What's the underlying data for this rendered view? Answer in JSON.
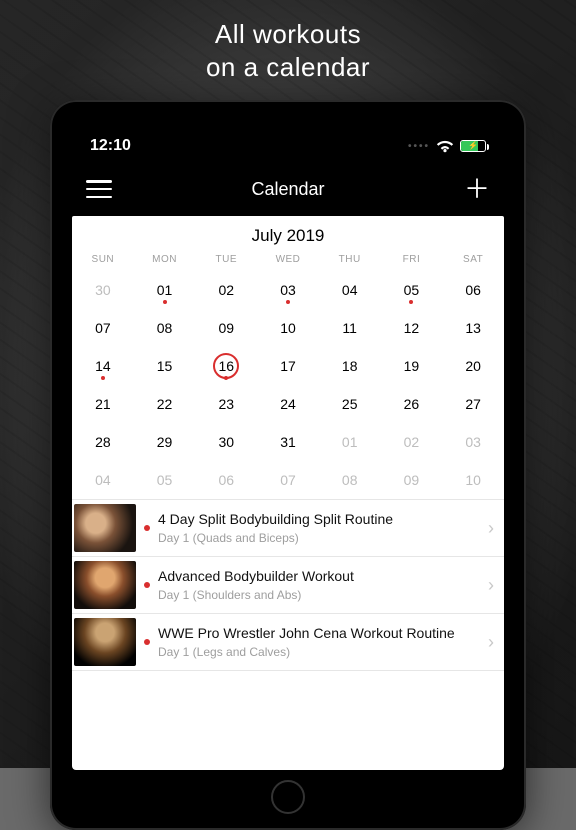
{
  "promo": {
    "line1": "All workouts",
    "line2": "on a calendar"
  },
  "status": {
    "time": "12:10"
  },
  "nav": {
    "title": "Calendar"
  },
  "calendar": {
    "month_label": "July 2019",
    "weekdays": [
      "SUN",
      "MON",
      "TUE",
      "WED",
      "THU",
      "FRI",
      "SAT"
    ],
    "weeks": [
      [
        {
          "d": "30",
          "o": true
        },
        {
          "d": "01",
          "dot": true
        },
        {
          "d": "02"
        },
        {
          "d": "03",
          "dot": true
        },
        {
          "d": "04"
        },
        {
          "d": "05",
          "dot": true
        },
        {
          "d": "06"
        }
      ],
      [
        {
          "d": "07"
        },
        {
          "d": "08"
        },
        {
          "d": "09"
        },
        {
          "d": "10"
        },
        {
          "d": "11"
        },
        {
          "d": "12"
        },
        {
          "d": "13"
        }
      ],
      [
        {
          "d": "14",
          "dot": true
        },
        {
          "d": "15"
        },
        {
          "d": "16",
          "today": true,
          "dot": true
        },
        {
          "d": "17"
        },
        {
          "d": "18"
        },
        {
          "d": "19"
        },
        {
          "d": "20"
        }
      ],
      [
        {
          "d": "21"
        },
        {
          "d": "22"
        },
        {
          "d": "23"
        },
        {
          "d": "24"
        },
        {
          "d": "25"
        },
        {
          "d": "26"
        },
        {
          "d": "27"
        }
      ],
      [
        {
          "d": "28"
        },
        {
          "d": "29"
        },
        {
          "d": "30"
        },
        {
          "d": "31"
        },
        {
          "d": "01",
          "o": true
        },
        {
          "d": "02",
          "o": true
        },
        {
          "d": "03",
          "o": true
        }
      ],
      [
        {
          "d": "04",
          "o": true
        },
        {
          "d": "05",
          "o": true
        },
        {
          "d": "06",
          "o": true
        },
        {
          "d": "07",
          "o": true
        },
        {
          "d": "08",
          "o": true
        },
        {
          "d": "09",
          "o": true
        },
        {
          "d": "10",
          "o": true
        }
      ]
    ]
  },
  "workouts": [
    {
      "title": "4 Day Split Bodybuilding Split Routine",
      "sub": "Day 1 (Quads and Biceps)",
      "grad": "tgrad1"
    },
    {
      "title": "Advanced Bodybuilder Workout",
      "sub": "Day 1 (Shoulders and Abs)",
      "grad": "tgrad2"
    },
    {
      "title": "WWE Pro Wrestler John Cena Workout Routine",
      "sub": "Day 1 (Legs and Calves)",
      "grad": "tgrad3"
    }
  ]
}
